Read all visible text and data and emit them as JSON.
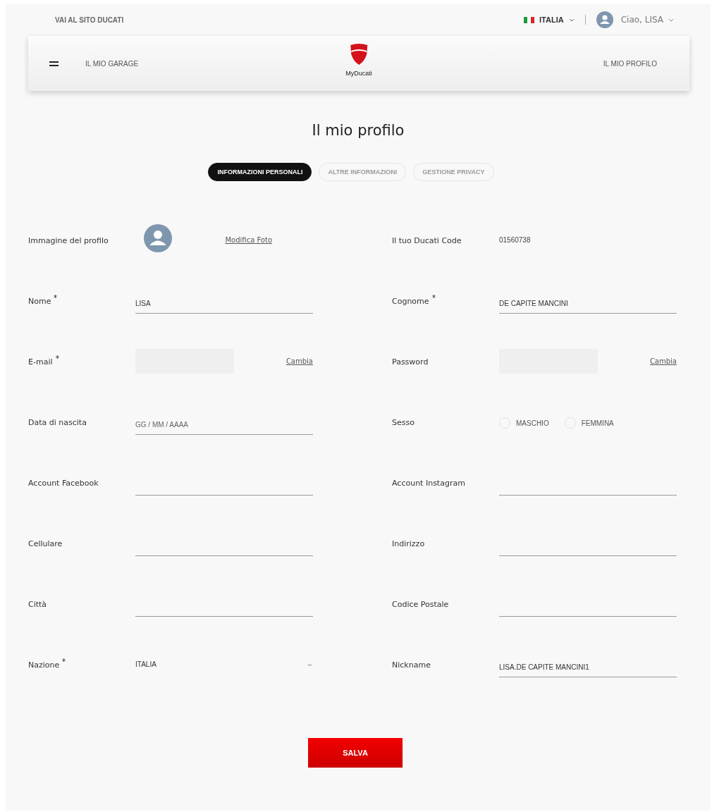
{
  "top_bar": {
    "site_link": "VAI AL SITO DUCATI",
    "country": "ITALIA",
    "greeting": "Ciao, LISA"
  },
  "nav": {
    "left_link": "IL MIO GARAGE",
    "logo_caption": "MyDucati",
    "right_link": "IL MIO PROFILO"
  },
  "title": "Il mio profilo",
  "tabs": [
    {
      "label": "INFORMAZIONI PERSONALI",
      "selected": true
    },
    {
      "label": "ALTRE INFORMAZIONI",
      "selected": false
    },
    {
      "label": "GESTIONE PRIVACY",
      "selected": false
    }
  ],
  "fields": [
    {
      "kind": "avatar",
      "label": "Immagine del profilo",
      "required": false,
      "link": "Modifica Foto"
    },
    {
      "kind": "static",
      "label": "Il tuo Ducati Code",
      "required": false,
      "value": "01560738"
    },
    {
      "kind": "text",
      "label": "Nome",
      "required": true,
      "value": "LISA"
    },
    {
      "kind": "text",
      "label": "Cognome",
      "required": true,
      "value": "DE CAPITE MANCINI"
    },
    {
      "kind": "masked",
      "label": "E-mail",
      "required": true,
      "link": "Cambia"
    },
    {
      "kind": "masked",
      "label": "Password",
      "required": false,
      "link": "Cambia"
    },
    {
      "kind": "text",
      "label": "Data di nascita",
      "required": false,
      "placeholder": "GG / MM / AAAA"
    },
    {
      "kind": "radio",
      "label": "Sesso",
      "required": false,
      "options": [
        {
          "label": "MASCHIO",
          "selected": false
        },
        {
          "label": "FEMMINA",
          "selected": false
        }
      ]
    },
    {
      "kind": "text",
      "label": "Account Facebook",
      "required": false
    },
    {
      "kind": "text",
      "label": "Account Instagram",
      "required": false
    },
    {
      "kind": "text",
      "label": "Cellulare",
      "required": false
    },
    {
      "kind": "text",
      "label": "Indirizzo",
      "required": false
    },
    {
      "kind": "text",
      "label": "Città",
      "required": false
    },
    {
      "kind": "text",
      "label": "Codice Postale",
      "required": false
    },
    {
      "kind": "select",
      "label": "Nazione",
      "required": true,
      "value": "ITALIA",
      "arrow": "–"
    },
    {
      "kind": "text",
      "label": "Nickname",
      "required": false,
      "value": "LISA.DE CAPITE MANCINI1"
    }
  ],
  "save_button": "SALVA"
}
